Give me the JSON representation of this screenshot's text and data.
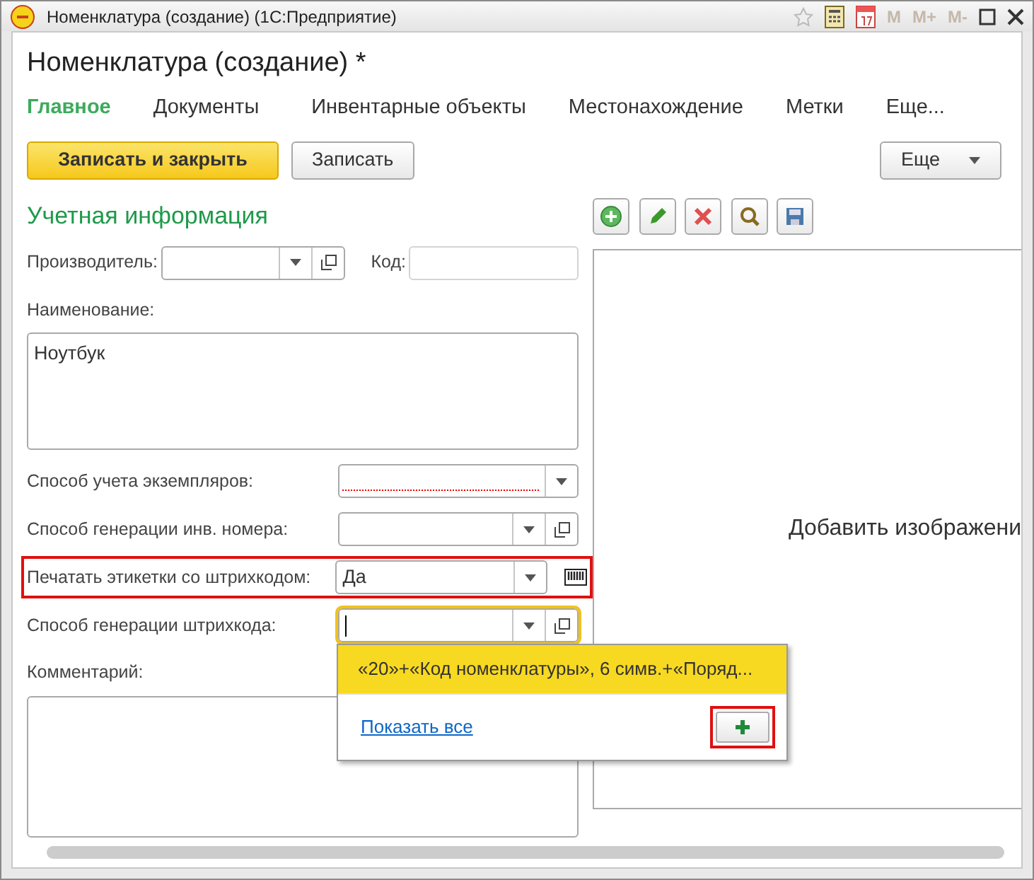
{
  "window": {
    "title": "Номенклатура (создание)  (1С:Предприятие)",
    "memory_buttons": [
      "M",
      "M+",
      "M-"
    ]
  },
  "form_title": "Номенклатура (создание) *",
  "tabs": [
    {
      "label": "Главное",
      "selected": true
    },
    {
      "label": "Документы",
      "selected": false
    },
    {
      "label": "Инвентарные объекты",
      "selected": false
    },
    {
      "label": "Местонахождение",
      "selected": false
    },
    {
      "label": "Метки",
      "selected": false
    },
    {
      "label": "Еще...",
      "selected": false
    }
  ],
  "commands": [
    {
      "label": "Записать и закрыть",
      "kind": "primary"
    },
    {
      "label": "Записать",
      "kind": "default"
    }
  ],
  "more_button": {
    "label": "Еще"
  },
  "section_title": "Учетная информация",
  "manufacturer": {
    "label": "Производитель:"
  },
  "code": {
    "label": "Код:"
  },
  "fields": [
    {
      "kind": "textarea",
      "label": "Наименование:",
      "value": "Ноутбук"
    },
    {
      "kind": "select",
      "label": "Способ учета экземпляров:",
      "open_button": false,
      "required": true,
      "highlighted": false,
      "focused": false,
      "barcode_button": false
    },
    {
      "kind": "select",
      "label": "Способ генерации инв. номера:",
      "open_button": true,
      "required": false,
      "highlighted": false,
      "focused": false,
      "barcode_button": false
    },
    {
      "kind": "select",
      "label": "Печатать этикетки со штрихкодом:",
      "value": "Да",
      "open_button": false,
      "required": false,
      "highlighted": true,
      "focused": false,
      "barcode_button": true
    },
    {
      "kind": "select",
      "label": "Способ генерации штрихкода:",
      "open_button": true,
      "required": false,
      "highlighted": false,
      "focused": true,
      "barcode_button": false
    },
    {
      "kind": "textarea",
      "label": "Комментарий:"
    }
  ],
  "dropdown": {
    "items": [
      {
        "label": "«20»+«Код номенклатуры», 6 симв.+«Поряд...",
        "selected": true
      }
    ],
    "show_all": "Показать все",
    "add_highlighted": true
  },
  "image_panel": {
    "placeholder": "Добавить изображени"
  }
}
